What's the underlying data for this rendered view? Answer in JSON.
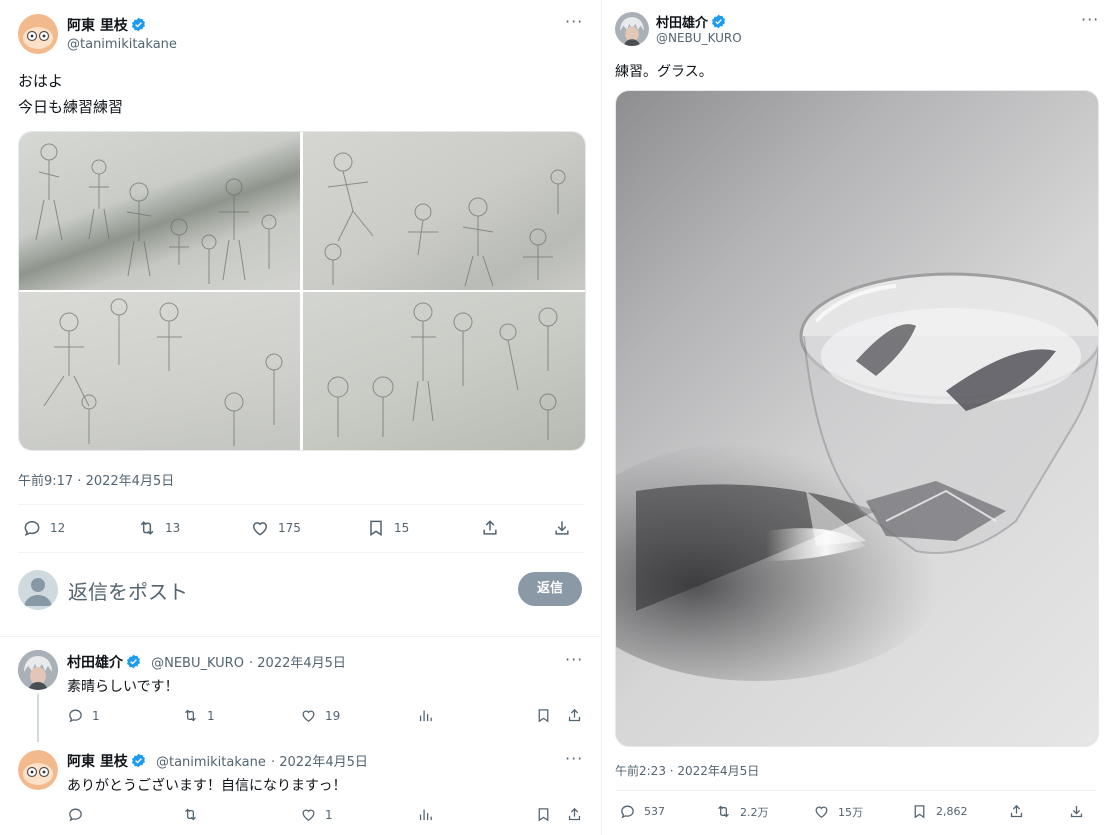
{
  "left_tweet": {
    "author": {
      "name": "阿東 里枝",
      "handle": "@tanimikitakane",
      "verified": true
    },
    "text_lines": [
      "おはよ",
      "今日も練習練習"
    ],
    "timestamp": "午前9:17 · 2022年4月5日",
    "stats": {
      "replies": "12",
      "retweets": "13",
      "likes": "175",
      "bookmarks": "15"
    },
    "reply_box": {
      "placeholder": "返信をポスト",
      "button_label": "返信"
    }
  },
  "replies": [
    {
      "name": "村田雄介",
      "handle": "@NEBU_KURO",
      "date": "· 2022年4月5日",
      "verified": true,
      "text": "素晴らしいです！",
      "stats": {
        "replies": "1",
        "retweets": "1",
        "likes": "19"
      }
    },
    {
      "name": "阿東 里枝",
      "handle": "@tanimikitakane",
      "date": "· 2022年4月5日",
      "verified": true,
      "text": "ありがとうございます！自信になりますっ！",
      "stats": {
        "likes": "1"
      }
    }
  ],
  "right_tweet": {
    "author": {
      "name": "村田雄介",
      "handle": "@NEBU_KURO",
      "verified": true
    },
    "text": "練習。グラス。",
    "timestamp": "午前2:23 · 2022年4月5日",
    "stats": {
      "replies": "537",
      "retweets": "2.2万",
      "likes": "15万",
      "bookmarks": "2,862"
    }
  },
  "icons": [
    "reply-icon",
    "retweet-icon",
    "like-icon",
    "bookmark-icon",
    "share-icon",
    "download-icon",
    "views-icon",
    "more-icon",
    "verified-icon"
  ],
  "colors": {
    "verified": "#1d9bf0",
    "secondary_text": "#536471",
    "divider": "#eff3f4",
    "reply_button": "#8b98a5"
  }
}
